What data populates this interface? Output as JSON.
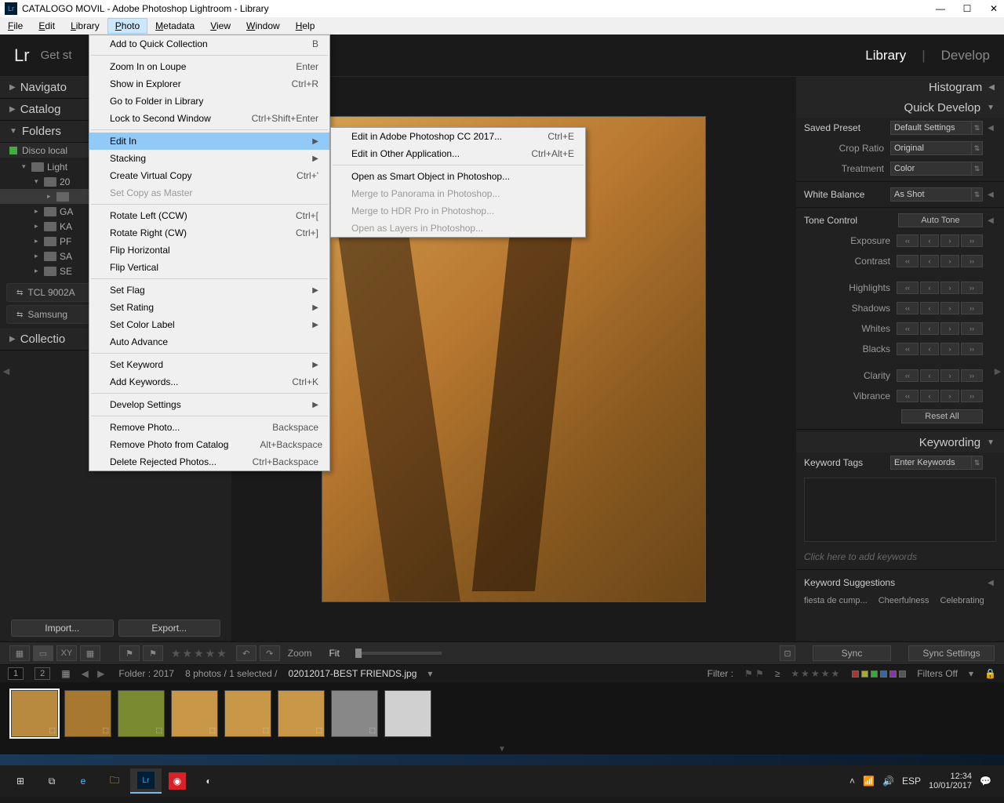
{
  "titlebar": {
    "title": "CATALOGO MOVIL - Adobe Photoshop Lightroom - Library"
  },
  "menubar": [
    "File",
    "Edit",
    "Library",
    "Photo",
    "Metadata",
    "View",
    "Window",
    "Help"
  ],
  "active_menu_index": 3,
  "topstrip": {
    "logo": "Lr",
    "getstarted": "Get st",
    "modules": [
      "Library",
      "Develop"
    ],
    "active_module": "Library"
  },
  "left": {
    "navigator": "Navigato",
    "catalog": "Catalog",
    "folders": "Folders",
    "collections": "Collectio",
    "disk": "Disco local",
    "tree": [
      {
        "indent": 1,
        "label": "Light",
        "exp": "▾"
      },
      {
        "indent": 2,
        "label": "20",
        "exp": "▾"
      },
      {
        "indent": 3,
        "label": "",
        "exp": "▸",
        "sel": true
      },
      {
        "indent": 2,
        "label": "GA",
        "exp": "▸"
      },
      {
        "indent": 2,
        "label": "KA",
        "exp": "▸"
      },
      {
        "indent": 2,
        "label": "PF",
        "exp": "▸"
      },
      {
        "indent": 2,
        "label": "SA",
        "exp": "▸"
      },
      {
        "indent": 2,
        "label": "SE",
        "exp": "▸"
      }
    ],
    "devices": [
      "TCL 9002A",
      "Samsung"
    ],
    "import_btn": "Import...",
    "export_btn": "Export..."
  },
  "right": {
    "histogram": "Histogram",
    "quickdev": "Quick Develop",
    "saved_preset_lbl": "Saved Preset",
    "saved_preset": "Default Settings",
    "crop_lbl": "Crop Ratio",
    "crop": "Original",
    "treat_lbl": "Treatment",
    "treat": "Color",
    "wb_lbl": "White Balance",
    "wb": "As Shot",
    "tone_lbl": "Tone Control",
    "autotone": "Auto Tone",
    "sliders": [
      "Exposure",
      "Contrast",
      "Highlights",
      "Shadows",
      "Whites",
      "Blacks",
      "Clarity",
      "Vibrance"
    ],
    "resetall": "Reset All",
    "keywording": "Keywording",
    "kwtags_lbl": "Keyword Tags",
    "kwtags": "Enter Keywords",
    "kwhint": "Click here to add keywords",
    "kwsugg_lbl": "Keyword Suggestions",
    "kwsugg": [
      "fiesta de cump...",
      "Cheerfulness",
      "Celebrating"
    ]
  },
  "toolbar": {
    "zoom": "Zoom",
    "fit": "Fit",
    "sync": "Sync",
    "syncset": "Sync Settings"
  },
  "statusbar": {
    "page1": "1",
    "page2": "2",
    "folder": "Folder : 2017",
    "count": "8 photos / 1 selected /",
    "filename": "02012017-BEST FRIENDS.jpg",
    "filter": "Filter :",
    "filtersoff": "Filters Off"
  },
  "photo_menu": [
    {
      "label": "Add to Quick Collection",
      "shortcut": "B"
    },
    {
      "sep": true
    },
    {
      "label": "Zoom In on Loupe",
      "shortcut": "Enter"
    },
    {
      "label": "Show in Explorer",
      "shortcut": "Ctrl+R"
    },
    {
      "label": "Go to Folder in Library"
    },
    {
      "label": "Lock to Second Window",
      "shortcut": "Ctrl+Shift+Enter"
    },
    {
      "sep": true
    },
    {
      "label": "Edit In",
      "sub": true,
      "hl": true
    },
    {
      "label": "Stacking",
      "sub": true
    },
    {
      "label": "Create Virtual Copy",
      "shortcut": "Ctrl+'"
    },
    {
      "label": "Set Copy as Master",
      "disabled": true
    },
    {
      "sep": true
    },
    {
      "label": "Rotate Left (CCW)",
      "shortcut": "Ctrl+["
    },
    {
      "label": "Rotate Right (CW)",
      "shortcut": "Ctrl+]"
    },
    {
      "label": "Flip Horizontal"
    },
    {
      "label": "Flip Vertical"
    },
    {
      "sep": true
    },
    {
      "label": "Set Flag",
      "sub": true
    },
    {
      "label": "Set Rating",
      "sub": true
    },
    {
      "label": "Set Color Label",
      "sub": true
    },
    {
      "label": "Auto Advance"
    },
    {
      "sep": true
    },
    {
      "label": "Set Keyword",
      "sub": true
    },
    {
      "label": "Add Keywords...",
      "shortcut": "Ctrl+K"
    },
    {
      "sep": true
    },
    {
      "label": "Develop Settings",
      "sub": true
    },
    {
      "sep": true
    },
    {
      "label": "Remove Photo...",
      "shortcut": "Backspace"
    },
    {
      "label": "Remove Photo from Catalog",
      "shortcut": "Alt+Backspace"
    },
    {
      "label": "Delete Rejected Photos...",
      "shortcut": "Ctrl+Backspace"
    }
  ],
  "editin_menu": [
    {
      "label": "Edit in Adobe Photoshop CC 2017...",
      "shortcut": "Ctrl+E"
    },
    {
      "label": "Edit in Other Application...",
      "shortcut": "Ctrl+Alt+E"
    },
    {
      "sep": true
    },
    {
      "label": "Open as Smart Object in Photoshop..."
    },
    {
      "label": "Merge to Panorama in Photoshop...",
      "disabled": true
    },
    {
      "label": "Merge to HDR Pro in Photoshop...",
      "disabled": true
    },
    {
      "label": "Open as Layers in Photoshop...",
      "disabled": true
    }
  ],
  "taskbar": {
    "lang": "ESP",
    "time": "12:34",
    "date": "10/01/2017"
  }
}
